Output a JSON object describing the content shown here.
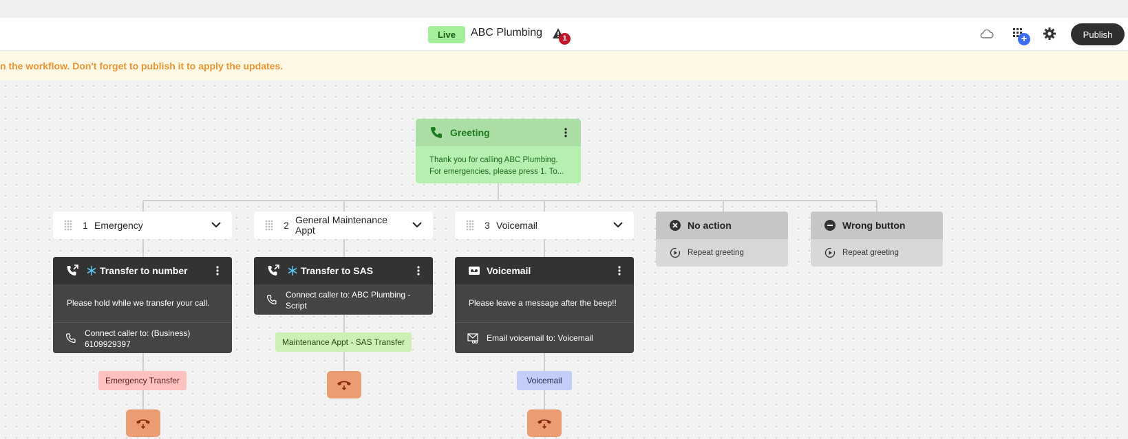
{
  "header": {
    "status_badge": "Live",
    "workflow_name": "ABC Plumbing",
    "alert_count": "1",
    "publish_label": "Publish",
    "icons": [
      "cloud-icon",
      "apps-grid-icon",
      "gear-icon",
      "warning-icon"
    ]
  },
  "banner": {
    "text": "n the workflow. Don't forget to publish it to apply the updates."
  },
  "greeting": {
    "title": "Greeting",
    "body_line1": "Thank you for calling ABC Plumbing.",
    "body_line2": "For emergencies, please press 1. To..."
  },
  "options": [
    {
      "number": "1",
      "label": "Emergency"
    },
    {
      "number": "2",
      "label": "General Maintenance Appt"
    },
    {
      "number": "3",
      "label": "Voicemail"
    }
  ],
  "extras": [
    {
      "title": "No action",
      "detail": "Repeat greeting"
    },
    {
      "title": "Wrong button",
      "detail": "Repeat greeting"
    }
  ],
  "actions": [
    {
      "title": "Transfer to number",
      "message": "Please hold while we transfer your call.",
      "connect_line1": "Connect caller to: (Business)",
      "connect_line2": "6109929397"
    },
    {
      "title": "Transfer to SAS",
      "connect_line1": "Connect caller to: ABC Plumbing -",
      "connect_line2": "Script"
    },
    {
      "title": "Voicemail",
      "message": "Please leave a message after the beep!!",
      "connect_line1": "Email voicemail to: Voicemail"
    }
  ],
  "tags": [
    {
      "label": "Emergency Transfer",
      "color": "#ffc0c0"
    },
    {
      "label": "Maintenance Appt - SAS Transfer",
      "color": "#cdf0b4"
    },
    {
      "label": "Voicemail",
      "color": "#c3cdf8"
    }
  ],
  "colors": {
    "greeting_header": "#abdea5",
    "greeting_body": "#b5f0b0",
    "action_header": "#333333",
    "action_body": "#444444",
    "hangup": "#eb9c72",
    "banner_text": "#e79434",
    "live_badge": "#a5ef9c"
  }
}
